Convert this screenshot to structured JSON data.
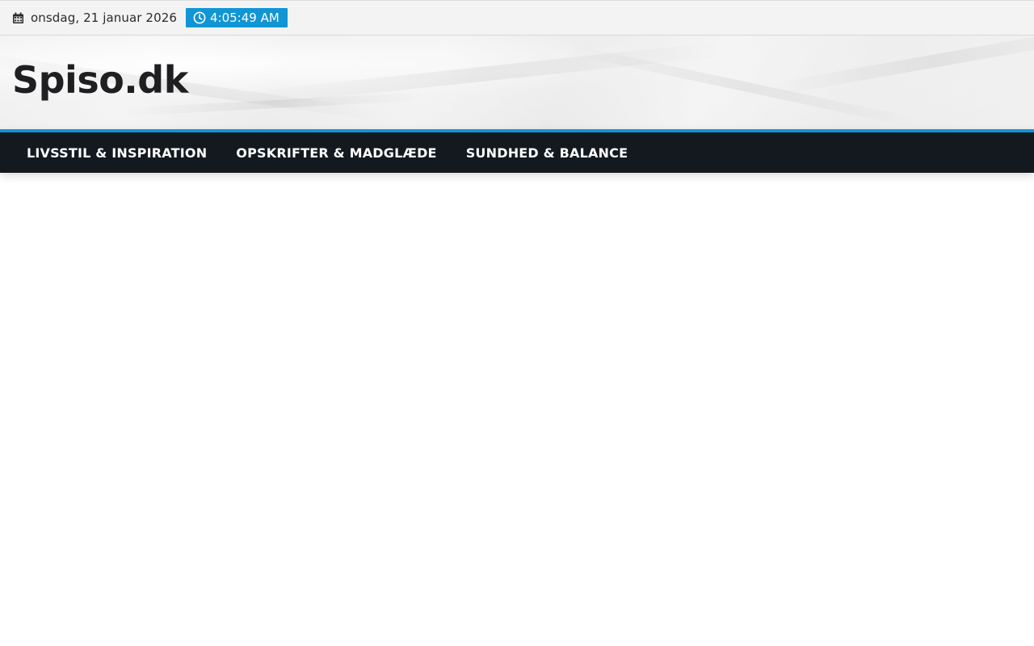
{
  "topbar": {
    "date": "onsdag, 21 januar 2026",
    "date_icon": "calendar-icon",
    "time": "4:05:49 AM",
    "time_icon": "clock-icon",
    "accent_color": "#1195d4"
  },
  "header": {
    "site_title": "Spiso.dk"
  },
  "nav": {
    "background_color": "#141920",
    "items": [
      {
        "label": "LIVSSTIL & INSPIRATION"
      },
      {
        "label": "OPSKRIFTER & MADGLÆDE"
      },
      {
        "label": "SUNDHED & BALANCE"
      }
    ]
  }
}
